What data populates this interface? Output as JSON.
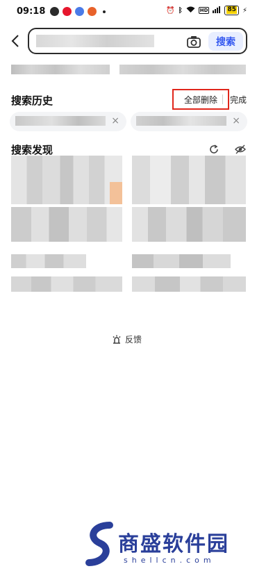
{
  "status_bar": {
    "time": "09:18",
    "battery": "85"
  },
  "search": {
    "placeholder": "",
    "button_label": "搜索"
  },
  "history": {
    "title": "搜索历史",
    "delete_all_label": "全部删除",
    "done_label": "完成",
    "close_glyph": "×"
  },
  "discover": {
    "title": "搜索发现"
  },
  "feedback": {
    "label": "反馈"
  },
  "watermark": {
    "name": "商盛软件园",
    "domain": "shellcn.com"
  }
}
